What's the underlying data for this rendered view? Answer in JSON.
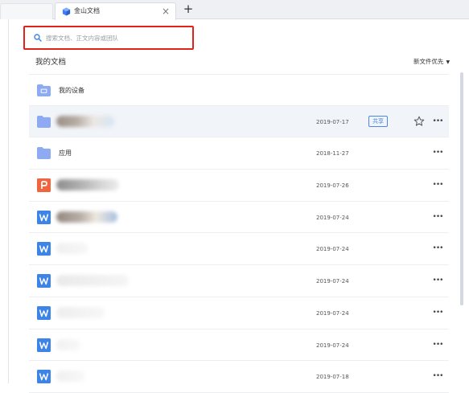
{
  "browser": {
    "tab_title": "金山文档",
    "close_glyph": "×",
    "new_tab_glyph": "+"
  },
  "search": {
    "placeholder": "搜索文档、正文内容或团队"
  },
  "header": {
    "title": "我的文档",
    "sort_label": "新文件优先",
    "sort_caret": "▼"
  },
  "colors": {
    "accent": "#4d86e8",
    "highlight_border": "#e2231a",
    "folder": "#8eaaf2",
    "doc_icon": "#3d84e8",
    "pdf_icon": "#f0653d",
    "selected_row": "#f1f4f9"
  },
  "files": [
    {
      "icon": "device-folder-icon",
      "name": "我的设备",
      "date": "",
      "shared": false,
      "starred_visible": false,
      "more": false
    },
    {
      "icon": "folder-icon",
      "name": "",
      "date": "2019-07-17",
      "shared": true,
      "share_label": "共享",
      "starred_visible": true,
      "more": true
    },
    {
      "icon": "folder-icon",
      "name": "应用",
      "date": "2018-11-27",
      "shared": false,
      "starred_visible": false,
      "more": true
    },
    {
      "icon": "presentation-icon",
      "name": "",
      "date": "2019-07-26",
      "shared": false,
      "starred_visible": false,
      "more": true
    },
    {
      "icon": "word-doc-icon",
      "name": "",
      "date": "2019-07-24",
      "shared": false,
      "starred_visible": false,
      "more": true
    },
    {
      "icon": "word-doc-icon",
      "name": "",
      "date": "2019-07-24",
      "shared": false,
      "starred_visible": false,
      "more": true
    },
    {
      "icon": "word-doc-icon",
      "name": "",
      "date": "2019-07-24",
      "shared": false,
      "starred_visible": false,
      "more": true
    },
    {
      "icon": "word-doc-icon",
      "name": "",
      "date": "2019-07-24",
      "shared": false,
      "starred_visible": false,
      "more": true
    },
    {
      "icon": "word-doc-icon",
      "name": "",
      "date": "2019-07-24",
      "shared": false,
      "starred_visible": false,
      "more": true
    },
    {
      "icon": "word-doc-icon",
      "name": "",
      "date": "2019-07-18",
      "shared": false,
      "starred_visible": false,
      "more": true
    }
  ],
  "more_glyph": "•••"
}
